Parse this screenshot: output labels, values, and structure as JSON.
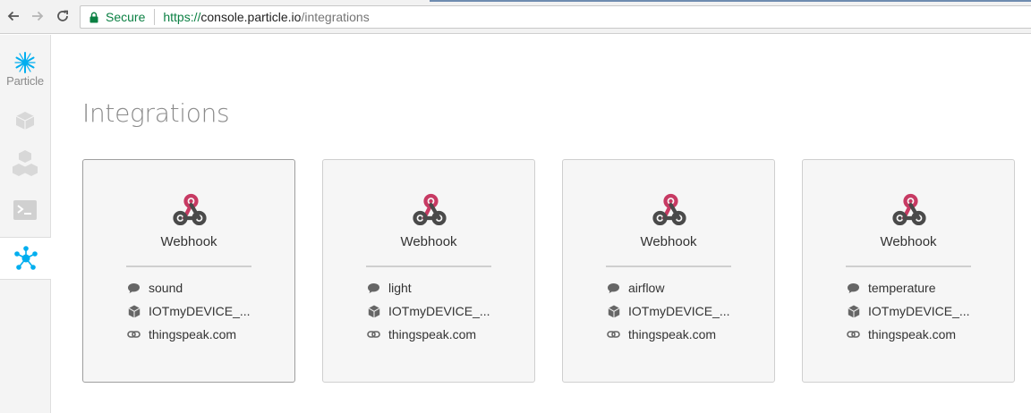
{
  "browser": {
    "secure_label": "Secure",
    "url_scheme": "https://",
    "url_host": "console.particle.io",
    "url_path": "/integrations"
  },
  "sidebar": {
    "logo_text": "Particle",
    "items": [
      {
        "icon": "device-cube-icon"
      },
      {
        "icon": "products-cubes-icon"
      },
      {
        "icon": "console-terminal-icon"
      },
      {
        "icon": "integrations-hub-icon",
        "active": true
      }
    ]
  },
  "page": {
    "title": "Integrations"
  },
  "integrations": [
    {
      "type": "Webhook",
      "event": "sound",
      "device": "IOTmyDEVICE_...",
      "target": "thingspeak.com"
    },
    {
      "type": "Webhook",
      "event": "light",
      "device": "IOTmyDEVICE_...",
      "target": "thingspeak.com"
    },
    {
      "type": "Webhook",
      "event": "airflow",
      "device": "IOTmyDEVICE_...",
      "target": "thingspeak.com"
    },
    {
      "type": "Webhook",
      "event": "temperature",
      "device": "IOTmyDEVICE_...",
      "target": "thingspeak.com"
    }
  ],
  "colors": {
    "accent": "#00aeef",
    "webhook_pink": "#c73a63",
    "webhook_dark": "#4a4a4a"
  }
}
